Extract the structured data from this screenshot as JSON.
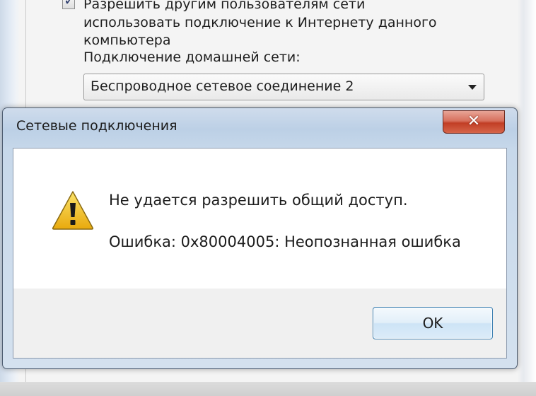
{
  "background_panel": {
    "share_checkbox_checked": true,
    "share_option_line1": "Разрешить другим пользователям сети",
    "share_option_line2": "использовать подключение к Интернету данного",
    "share_option_line3": "компьютера",
    "home_network_label": "Подключение домашней сети:",
    "home_network_selected": "Беспроводное сетевое соединение 2"
  },
  "dialog": {
    "title": "Сетевые подключения",
    "close_glyph": "✕",
    "message": "Не удается разрешить общий доступ.",
    "error_text": "Ошибка: 0x80004005: Неопознанная ошибка",
    "ok_label": "OK",
    "icon": "warning-icon"
  },
  "colors": {
    "title_bar": "#bcd0e6",
    "close_button": "#c13e25",
    "warning_yellow": "#f2c21b",
    "ok_border": "#3c7fb1"
  }
}
